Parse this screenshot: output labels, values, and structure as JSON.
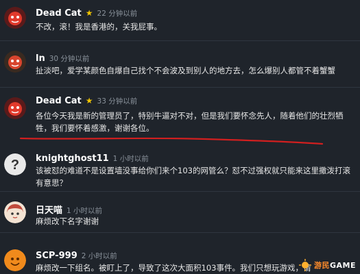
{
  "comments": [
    {
      "name": "Dead Cat",
      "starred": true,
      "time": "22 分钟以前",
      "text": "不改，滚！我是香港的，关我屁事。",
      "avatar": "red-cartoon-avatar"
    },
    {
      "name": "ln",
      "starred": false,
      "time": "30 分钟以前",
      "text": "扯淡吧，爱学某颜色自爆自己找个不会波及到别人的地方去，怎么爆别人都管不着蟹蟹",
      "avatar": "red-cartoon-avatar"
    },
    {
      "name": "Dead Cat",
      "starred": true,
      "time": "33 分钟以前",
      "text": "各位今天我是新的管理员了，特别牛逼对不对，但是我们要怀念先人，随着他们的壮烈牺牲，我们要怀着感激，谢谢各位。",
      "avatar": "red-cartoon-avatar"
    },
    {
      "name": "knightghost11",
      "starred": false,
      "time": "1 小时以前",
      "text": "该被怼的难道不是设置墙没事给你们来个103的网管么？怼不过强权就只能来这里撒泼打滚有意思？",
      "avatar": "question-mark-avatar"
    },
    {
      "name": "日天喵",
      "starred": false,
      "time": "1 小时以前",
      "text": "麻烦改下名字谢谢",
      "avatar": "anime-girl-avatar"
    },
    {
      "name": "SCP-999",
      "starred": false,
      "time": "2 小时以前",
      "text": "麻烦改一下组名。被盯上了，导致了这次大面积103事件。我们只想玩游戏，请",
      "avatar": "orange-blob-avatar"
    }
  ],
  "watermark": {
    "cn": "游民",
    "en": "GAME"
  },
  "colors": {
    "background": "#1f242b",
    "star": "#f2c500",
    "annotation": "#d21f1f"
  }
}
